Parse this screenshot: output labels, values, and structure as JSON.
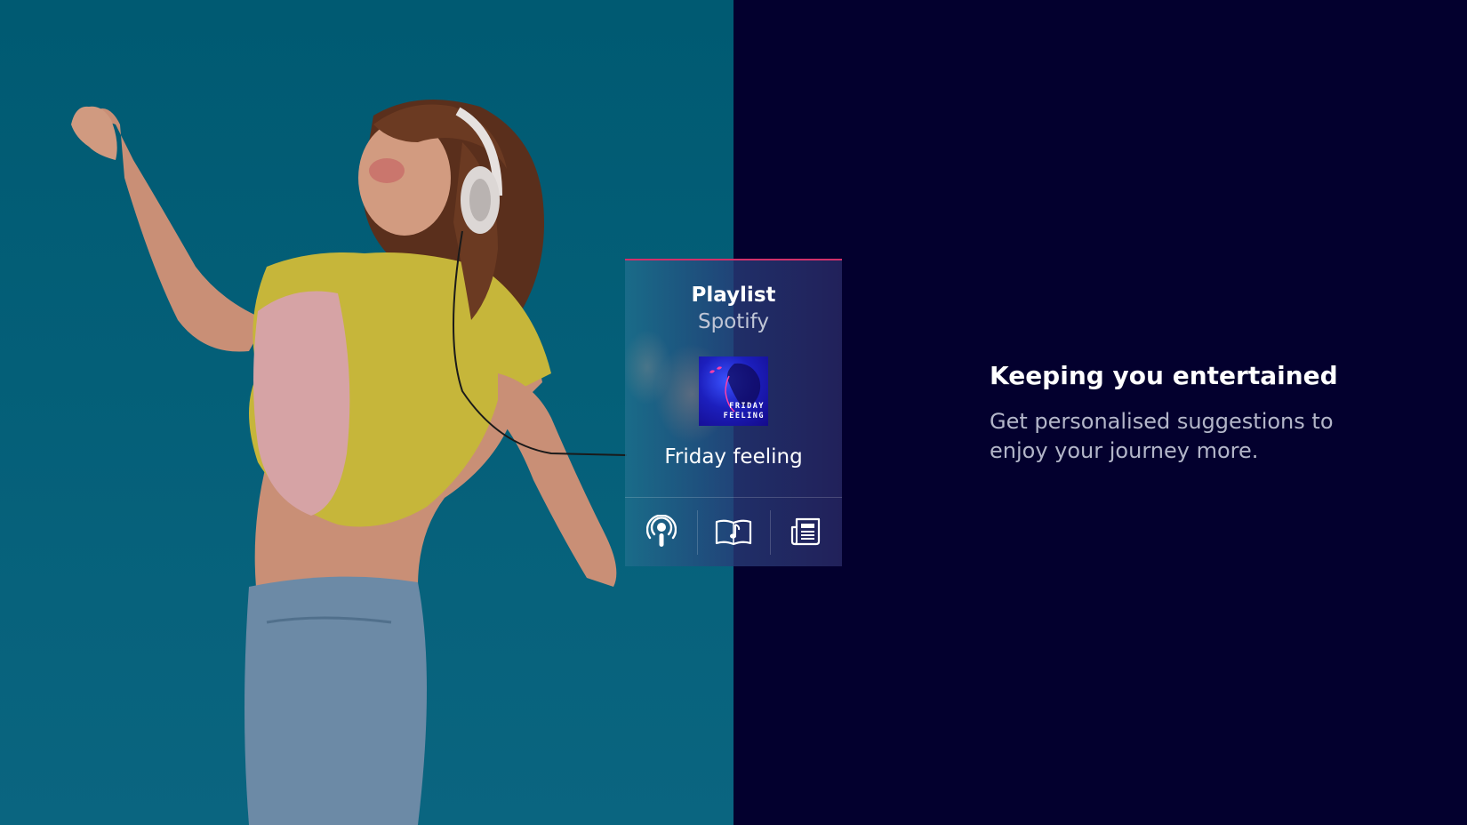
{
  "hero": {
    "image_alt": "Woman with headphones dancing"
  },
  "card": {
    "type_label": "Playlist",
    "provider": "Spotify",
    "cover_text": "FRIDAY FEELING",
    "track_title": "Friday feeling",
    "accent_color": "#d0306a",
    "actions": [
      {
        "icon": "podcast-icon"
      },
      {
        "icon": "music-book-icon"
      },
      {
        "icon": "newspaper-icon"
      }
    ]
  },
  "promo": {
    "headline": "Keeping you entertained",
    "body": "Get personalised suggestions to enjoy your journey more."
  }
}
